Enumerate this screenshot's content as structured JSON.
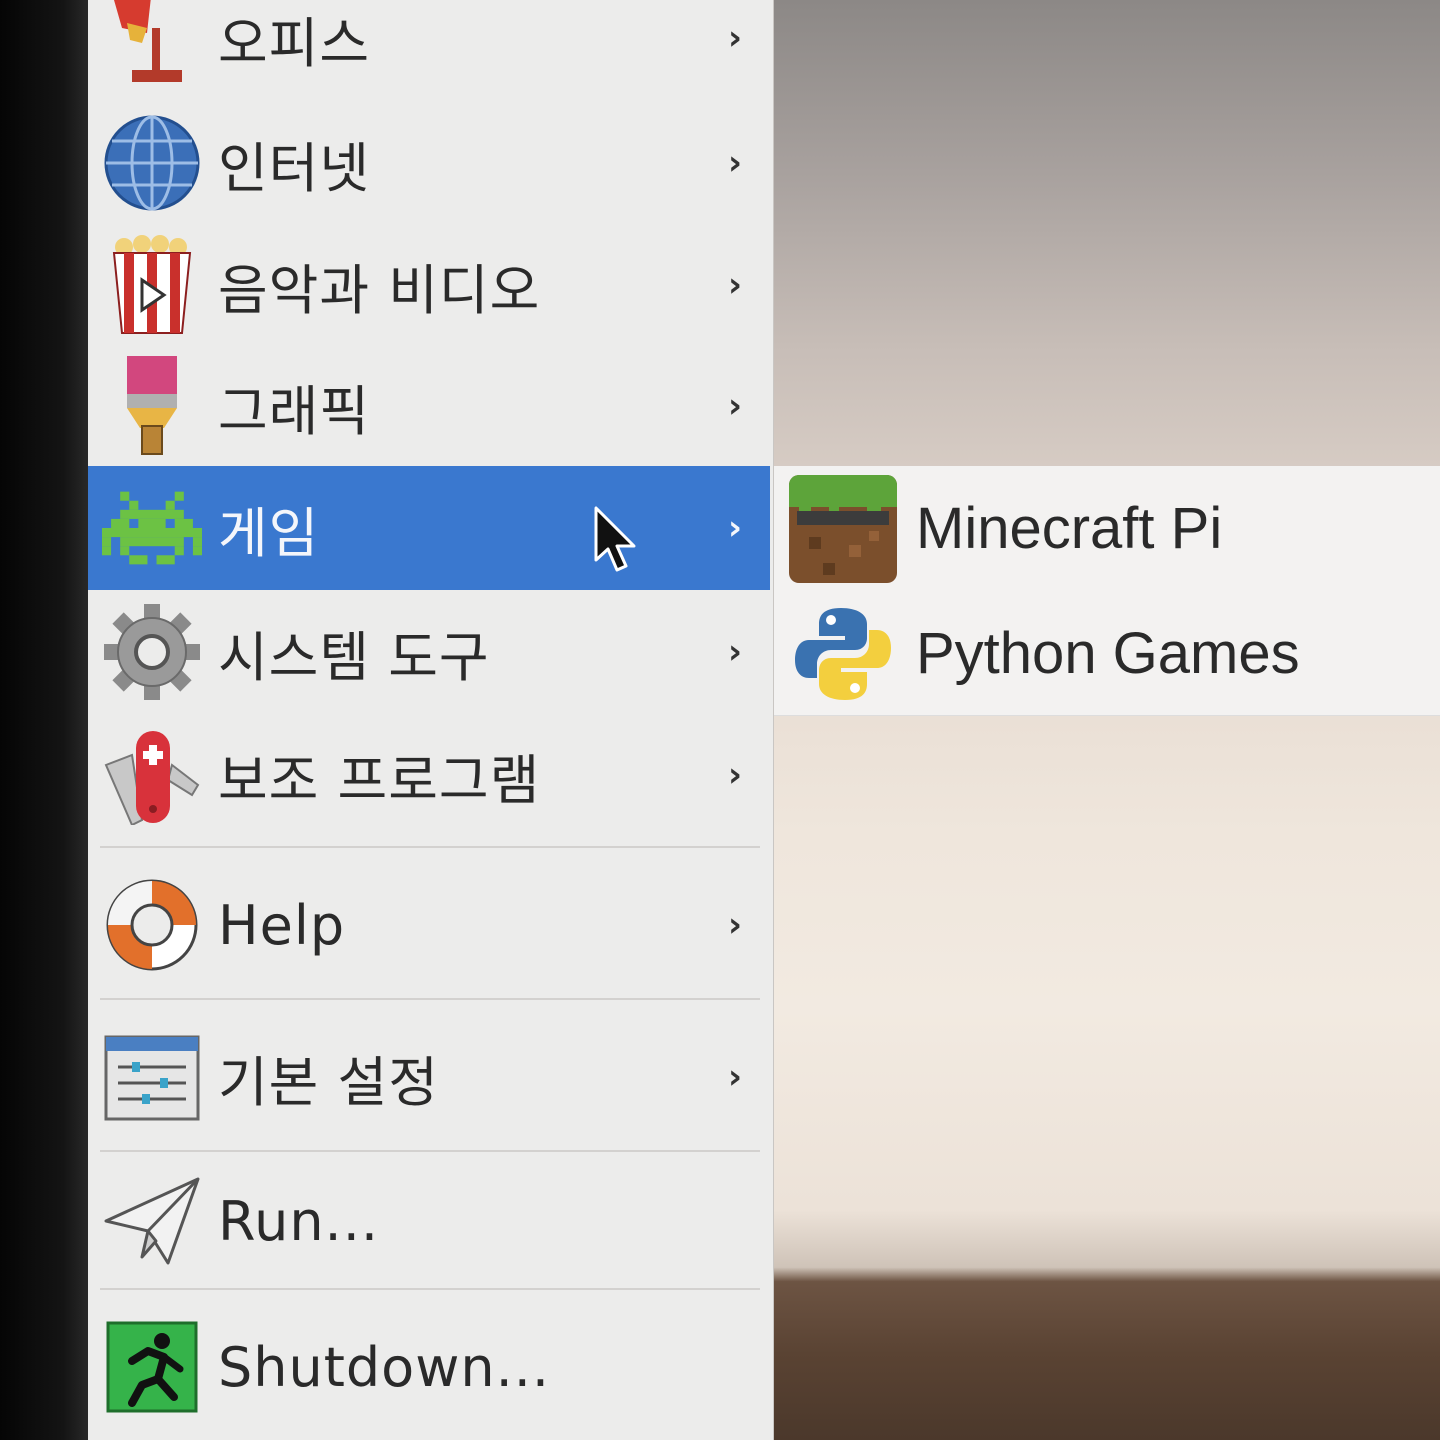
{
  "main_menu": {
    "items": [
      {
        "label": "오피스",
        "icon": "office-lamp-icon",
        "has_submenu": true
      },
      {
        "label": "인터넷",
        "icon": "globe-icon",
        "has_submenu": true
      },
      {
        "label": "음악과 비디오",
        "icon": "popcorn-video-icon",
        "has_submenu": true
      },
      {
        "label": "그래픽",
        "icon": "paintbrush-icon",
        "has_submenu": true
      },
      {
        "label": "게임",
        "icon": "space-invader-icon",
        "has_submenu": true,
        "selected": true
      },
      {
        "label": "시스템 도구",
        "icon": "gear-icon",
        "has_submenu": true
      },
      {
        "label": "보조 프로그램",
        "icon": "swiss-knife-icon",
        "has_submenu": true
      },
      {
        "label": "Help",
        "icon": "lifebuoy-icon",
        "has_submenu": true
      },
      {
        "label": "기본 설정",
        "icon": "settings-sliders-icon",
        "has_submenu": true
      },
      {
        "label": "Run...",
        "icon": "paper-plane-icon",
        "has_submenu": false
      },
      {
        "label": "Shutdown...",
        "icon": "exit-runner-icon",
        "has_submenu": false
      }
    ],
    "chevron": "›"
  },
  "games_submenu": {
    "items": [
      {
        "label": "Minecraft Pi",
        "icon": "minecraft-icon"
      },
      {
        "label": "Python Games",
        "icon": "python-icon"
      }
    ]
  },
  "colors": {
    "selection": "#3a78cf",
    "menu_background": "#ececeb",
    "text": "#2a2a2a"
  }
}
